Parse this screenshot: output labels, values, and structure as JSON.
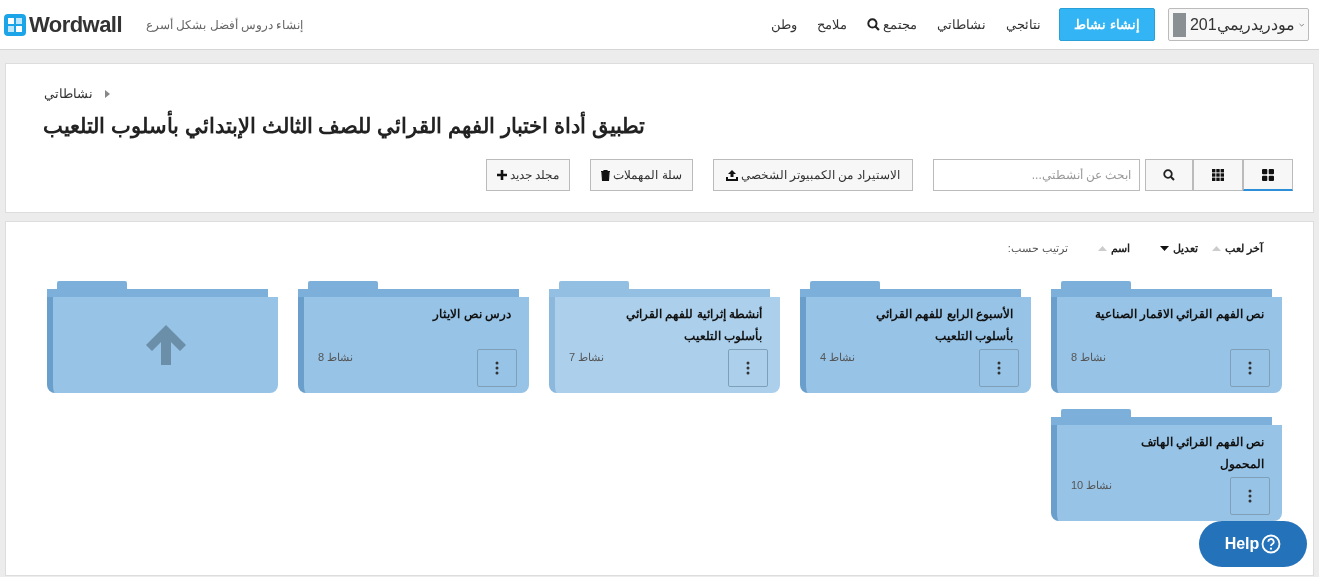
{
  "header": {
    "logo": "Wordwall",
    "tagline": "إنشاء دروس أفضل بشكل أسرع",
    "user": {
      "name": "مودريدريمي201"
    },
    "create_button": "إنشاء نشاط",
    "nav": [
      {
        "label": "نتائجي",
        "kind": "plain"
      },
      {
        "label": "نشاطاتي",
        "kind": "plain"
      },
      {
        "label": "مجتمع",
        "kind": "search"
      },
      {
        "label": "ملامح",
        "kind": "plain"
      },
      {
        "label": "وطن",
        "kind": "plain"
      }
    ]
  },
  "breadcrumb": "نشاطاتي",
  "title": "تطبيق أداة اختبار الفهم القرائي للصف الثالث الإبتدائي بأسلوب التلعيب",
  "toolbar": {
    "views": [
      {
        "kind": "large",
        "selected": true
      },
      {
        "kind": "small",
        "selected": false
      }
    ],
    "search_placeholder": "ابحث عن أنشطتي...",
    "import_button": "الاستيراد من الكمبيوتر الشخصي",
    "trash_button": "سلة المهملات",
    "new_folder_button": "مجلد جديد"
  },
  "sort": {
    "label": "ترتيب حسب:",
    "options": [
      {
        "label": "آخر لعب",
        "selected": false
      },
      {
        "label": "تعديل",
        "selected": true
      },
      {
        "label": "اسم",
        "selected": false
      }
    ]
  },
  "folders": [
    {
      "kind": "folder",
      "name": "نص الفهم القرائي الاقمار الصناعية",
      "count": "نشاط 8",
      "hovered": false
    },
    {
      "kind": "folder",
      "name": "الأسبوع الرابع للفهم القرائي بأسلوب التلعيب",
      "count": "نشاط 4",
      "hovered": false
    },
    {
      "kind": "folder",
      "name": "أنشطة إثرائية للفهم القرائي بأسلوب التلعيب",
      "count": "نشاط 7",
      "hovered": true
    },
    {
      "kind": "folder",
      "name": "درس نص الايثار",
      "count": "نشاط 8",
      "hovered": false
    },
    {
      "kind": "up"
    },
    {
      "kind": "folder",
      "name": "نص الفهم القرائي الهاتف المحمول",
      "count": "نشاط 10",
      "hovered": false
    }
  ],
  "help_button": "Help"
}
